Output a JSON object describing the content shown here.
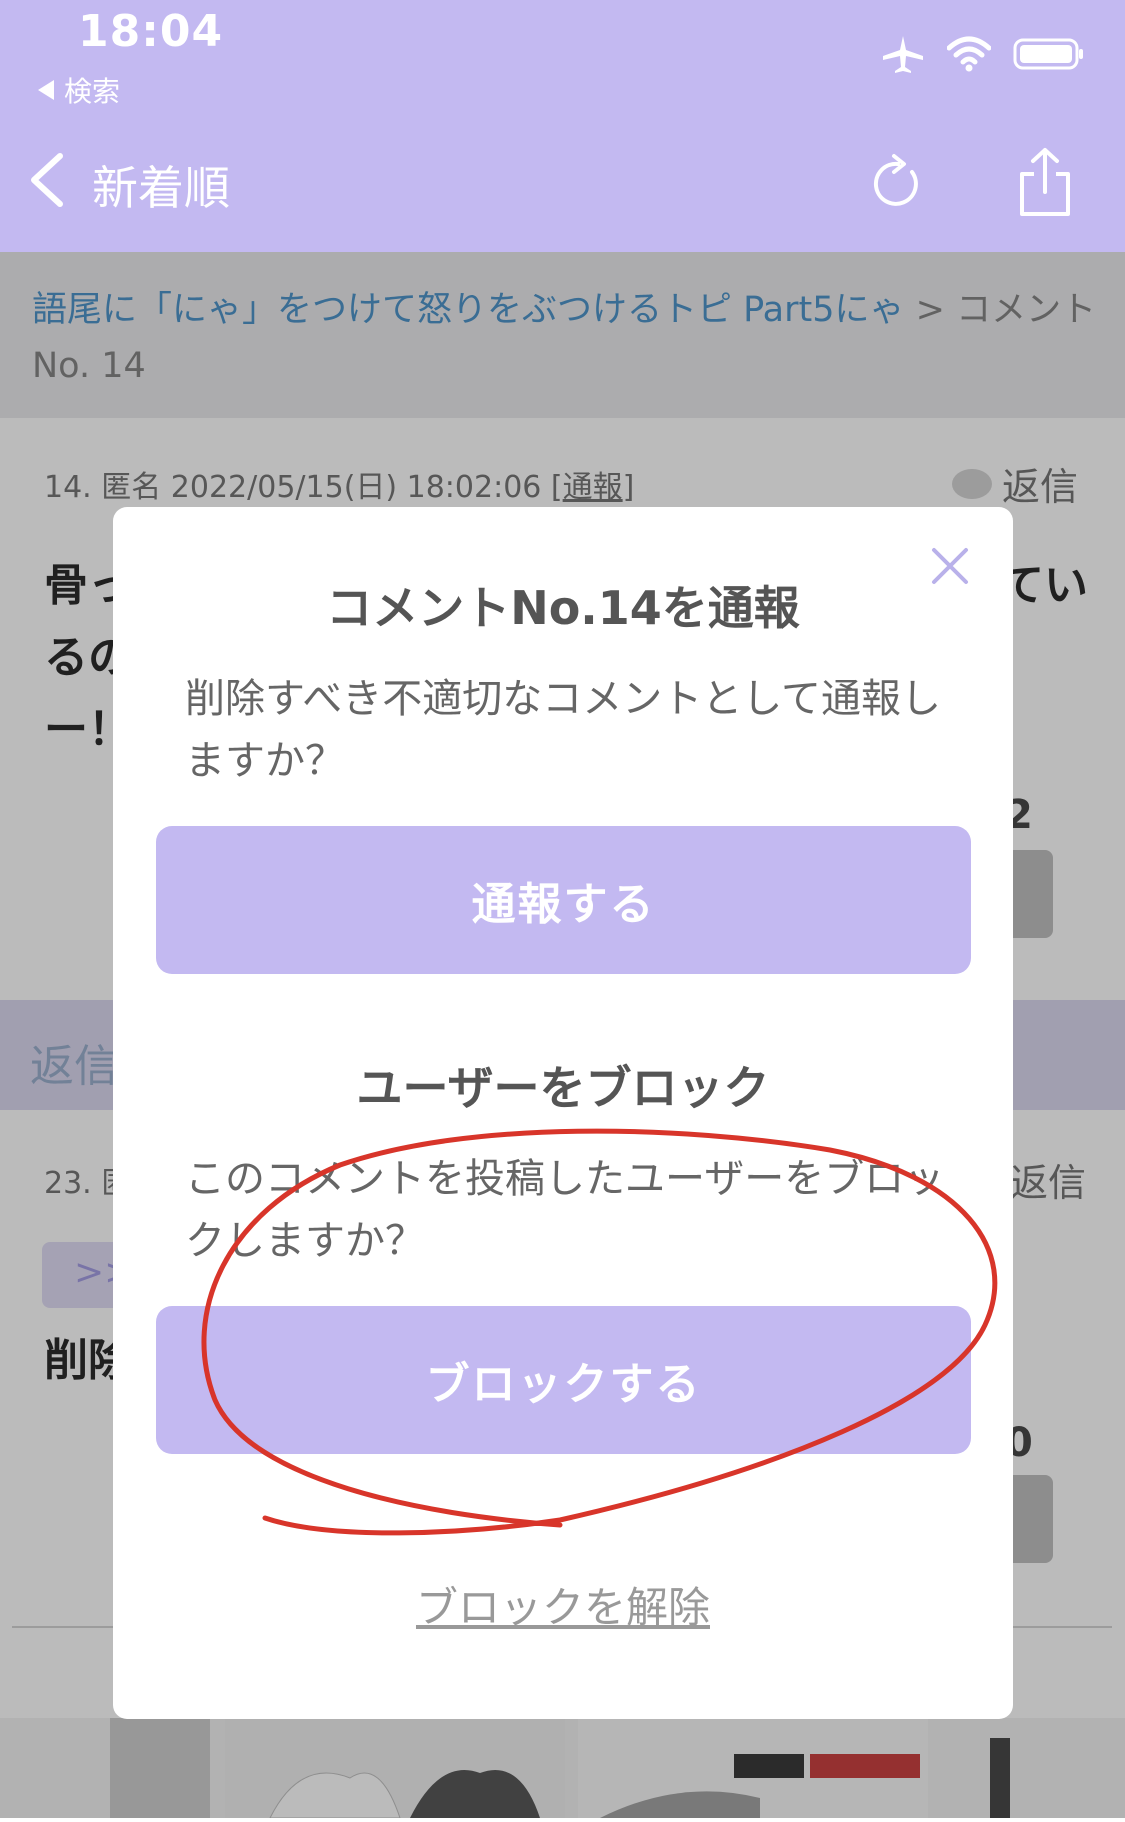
{
  "status_bar": {
    "time": "18:04",
    "back_label": "検索"
  },
  "nav": {
    "title": "新着順"
  },
  "breadcrumb": {
    "link": "語尾に「にゃ」をつけて怒りをぶつけるトピ Part5にゃ",
    "separator": " > ",
    "current": "コメント No. 14"
  },
  "post": {
    "meta": "14. 匿名 2022/05/15(日) 18:02:06 [",
    "report_link": "通報",
    "meta_end": "]",
    "reply": "返信",
    "body_visible": [
      "骨っ",
      "るの",
      "ー！"
    ],
    "body_right": "てい",
    "vote_count_partial": "2"
  },
  "reply_bar": {
    "label": "返信"
  },
  "post2": {
    "meta_partial": "23. 匿",
    "reply": "返信",
    "quote_partial": ">>",
    "body_partial": "削除",
    "vote_count_partial": "0"
  },
  "modal": {
    "report_title": "コメントNo.14を通報",
    "report_text": "削除すべき不適切なコメントとして通報しますか？",
    "report_button": "通報する",
    "block_title": "ユーザーをブロック",
    "block_text": "このコメントを投稿したユーザーをブロックしますか？",
    "block_button": "ブロックする",
    "unblock_link": "ブロックを解除"
  },
  "colors": {
    "accent": "#c3b9f1",
    "link": "#3a88c4",
    "annotation": "#d8352a"
  }
}
